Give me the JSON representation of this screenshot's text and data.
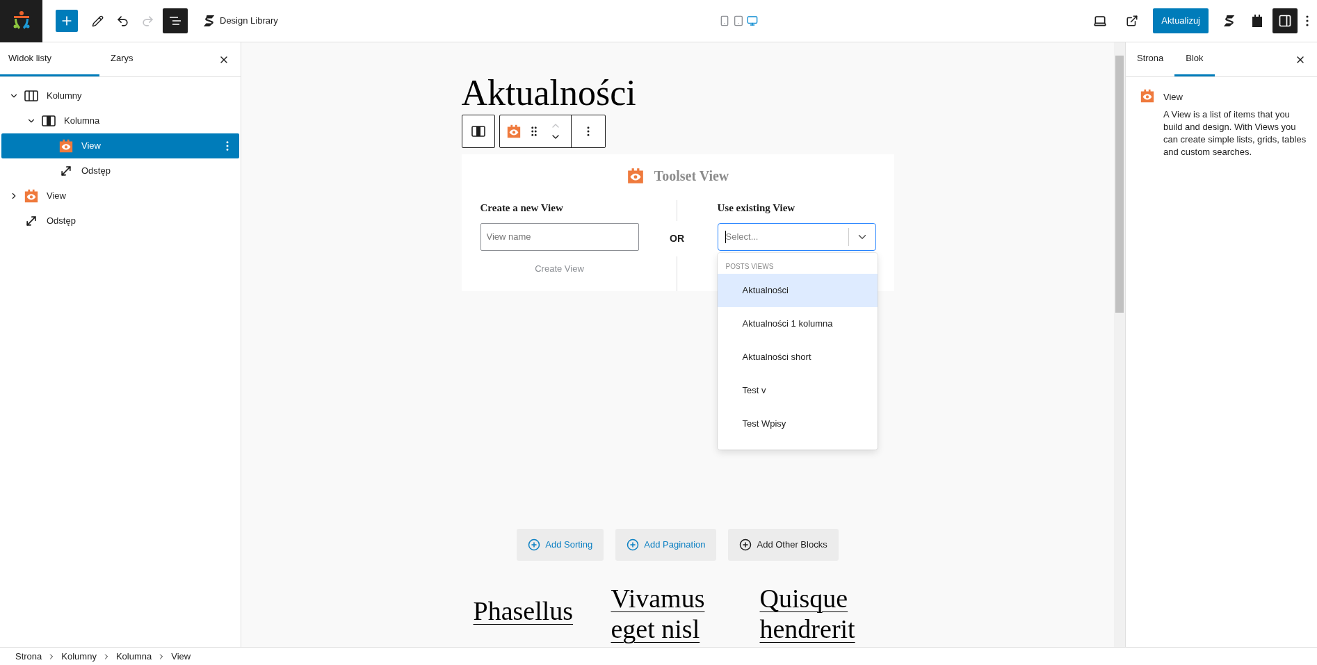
{
  "top_bar": {
    "redo_disabled": true,
    "list_view_selected": true,
    "document_title": "Design Library",
    "devices": [
      {
        "kind": "mobile",
        "selected": false
      },
      {
        "kind": "tablet",
        "selected": false
      },
      {
        "kind": "desktop",
        "selected": true
      }
    ],
    "update_button": "Aktualizuj",
    "settings_selected": true
  },
  "left_panel": {
    "tabs": [
      {
        "label": "Widok listy",
        "selected": true
      },
      {
        "label": "Zarys",
        "selected": false
      }
    ],
    "tree": [
      {
        "label": "Kolumny",
        "kind": "columns",
        "expanded": true,
        "selected": false,
        "children": [
          {
            "label": "Kolumna",
            "kind": "column",
            "expanded": true,
            "selected": false,
            "children": [
              {
                "label": "View",
                "kind": "view",
                "selected": true
              },
              {
                "label": "Odstęp",
                "kind": "spacer",
                "selected": false
              }
            ]
          }
        ]
      },
      {
        "label": "View",
        "kind": "view",
        "expanded": false,
        "selected": false
      },
      {
        "label": "Odstęp",
        "kind": "spacer",
        "selected": false
      }
    ]
  },
  "editor": {
    "title": "Aktualności",
    "toolbar": {
      "move_up_disabled": true
    },
    "toolset_view": {
      "heading": "Toolset View",
      "create_heading": "Create a new View",
      "name_placeholder": "View name",
      "create_button": "Create View",
      "or": "OR",
      "existing_heading": "Use existing View",
      "select_placeholder": "Select...",
      "dropdown": {
        "group": "POSTS VIEWS",
        "options": [
          {
            "label": "Aktualności",
            "selected": true
          },
          {
            "label": "Aktualności 1 kolumna",
            "selected": false
          },
          {
            "label": "Aktualności short",
            "selected": false
          },
          {
            "label": "Test v",
            "selected": false
          },
          {
            "label": "Test Wpisy",
            "selected": false
          }
        ]
      }
    },
    "actions": [
      {
        "label": "Add Sorting",
        "kind": "accent"
      },
      {
        "label": "Add Pagination",
        "kind": "accent"
      },
      {
        "label": "Add Other Blocks",
        "kind": "plain"
      }
    ],
    "posts": [
      {
        "title": "Phasellus"
      },
      {
        "title": "Vivamus eget nisl"
      },
      {
        "title": "Quisque hendrerit"
      }
    ]
  },
  "right_panel": {
    "tabs": [
      {
        "label": "Strona",
        "selected": false
      },
      {
        "label": "Blok",
        "selected": true
      }
    ],
    "block": {
      "name": "View",
      "description": "A View is a list of items that you build and design. With Views you can create simple lists, grids, tables and custom searches."
    }
  },
  "breadcrumbs": [
    "Strona",
    "Kolumny",
    "Kolumna",
    "View"
  ]
}
